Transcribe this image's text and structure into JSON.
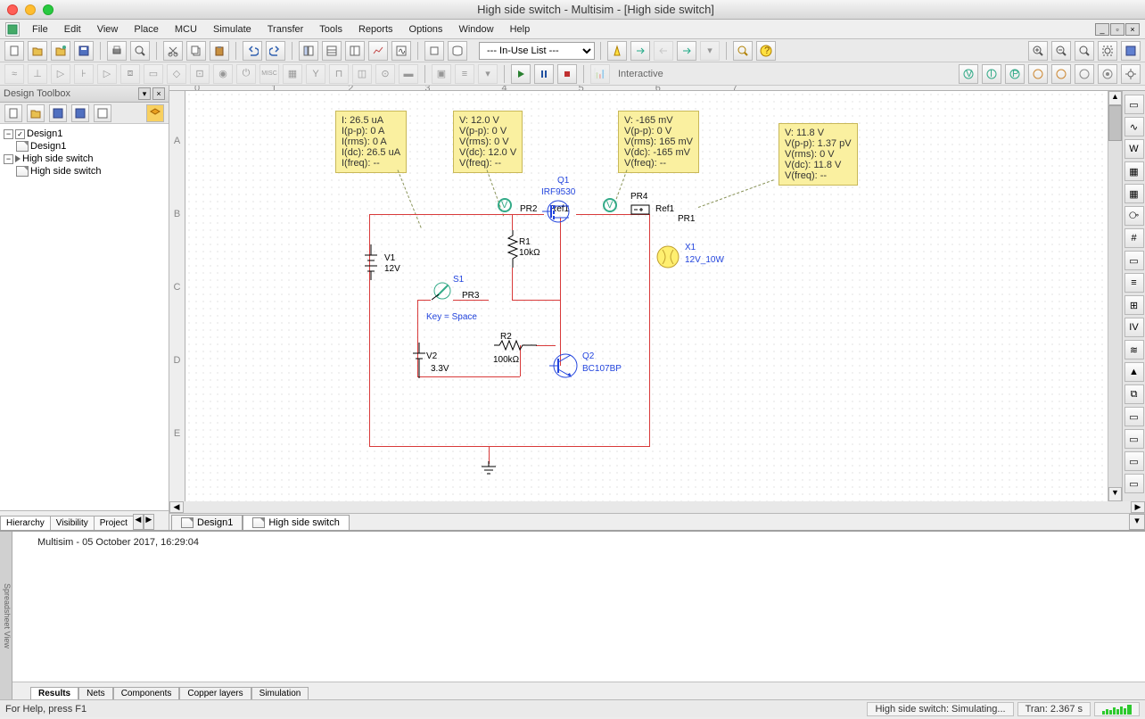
{
  "window": {
    "title": "High side switch - Multisim - [High side switch]"
  },
  "menu": {
    "items": [
      "File",
      "Edit",
      "View",
      "Place",
      "MCU",
      "Simulate",
      "Transfer",
      "Tools",
      "Reports",
      "Options",
      "Window",
      "Help"
    ]
  },
  "toolbar": {
    "dropdown": "--- In-Use List ---",
    "interactive_label": "Interactive"
  },
  "panel": {
    "title": "Design Toolbox",
    "side_tabs": [
      "Hierarchy",
      "Visibility",
      "Project"
    ]
  },
  "tree": {
    "n0": "Design1",
    "n0_0": "Design1",
    "n1": "High side switch",
    "n1_0": "High side switch"
  },
  "doc_tabs": {
    "t0": "Design1",
    "t1": "High side switch"
  },
  "probes": {
    "p1": {
      "l0": "I: 26.5 uA",
      "l1": "I(p-p): 0 A",
      "l2": "I(rms): 0 A",
      "l3": "I(dc): 26.5 uA",
      "l4": "I(freq): --"
    },
    "p2": {
      "l0": "V: 12.0 V",
      "l1": "V(p-p): 0 V",
      "l2": "V(rms): 0 V",
      "l3": "V(dc): 12.0 V",
      "l4": "V(freq): --"
    },
    "p3": {
      "l0": "V: -165 mV",
      "l1": "V(p-p): 0 V",
      "l2": "V(rms): 165 mV",
      "l3": "V(dc): -165 mV",
      "l4": "V(freq): --"
    },
    "p4": {
      "l0": "V: 11.8 V",
      "l1": "V(p-p): 1.37 pV",
      "l2": "V(rms): 0 V",
      "l3": "V(dc): 11.8 V",
      "l4": "V(freq): --"
    }
  },
  "components": {
    "q1_name": "Q1",
    "q1_model": "IRF9530",
    "pr2": "PR2",
    "ref1a": "Ref1",
    "pr4": "PR4",
    "ref1b": "Ref1",
    "pr1": "PR1",
    "v1_name": "V1",
    "v1_val": "12V",
    "r1_name": "R1",
    "r1_val": "10kΩ",
    "x1_name": "X1",
    "x1_val": "12V_10W",
    "s1_name": "S1",
    "pr3": "PR3",
    "s1_key": "Key = Space",
    "r2_name": "R2",
    "r2_val": "100kΩ",
    "v2_name": "V2",
    "v2_val": "3.3V",
    "q2_name": "Q2",
    "q2_model": "BC107BP"
  },
  "output": {
    "line": "Multisim  -  05 October 2017, 16:29:04",
    "tabs": [
      "Results",
      "Nets",
      "Components",
      "Copper layers",
      "Simulation"
    ],
    "handle": "Spreadsheet View"
  },
  "status": {
    "help": "For Help, press F1",
    "sim": "High side switch: Simulating...",
    "tran": "Tran: 2.367 s"
  },
  "rulers": {
    "h": [
      "0",
      "1",
      "2",
      "3",
      "4",
      "5",
      "6",
      "7"
    ],
    "v": [
      "A",
      "B",
      "C",
      "D",
      "E"
    ]
  }
}
